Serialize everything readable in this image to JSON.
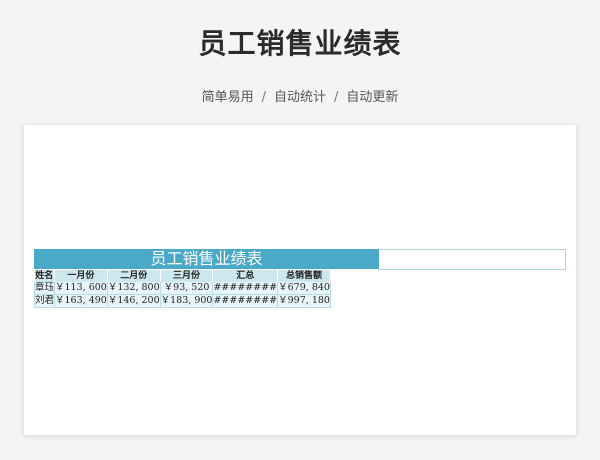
{
  "page": {
    "title": "员工销售业绩表",
    "tags": [
      "简单易用",
      "自动统计",
      "自动更新"
    ]
  },
  "sheet": {
    "banner_title": "员工销售业绩表",
    "headers": [
      "姓名",
      "一月份",
      "二月份",
      "三月份",
      "汇总",
      "总销售额"
    ],
    "rows": [
      [
        "章珏",
        "￥113, 600",
        "￥132, 800",
        "￥93, 520",
        "########",
        "￥679, 840"
      ],
      [
        "刘君",
        "￥163, 490",
        "￥146, 200",
        "￥183, 900",
        "########",
        "￥997, 180"
      ]
    ]
  },
  "colors": {
    "banner_bg": "#4aa9c7",
    "header_bg": "#cde7ef",
    "row_bg": "#e7f4f8"
  }
}
